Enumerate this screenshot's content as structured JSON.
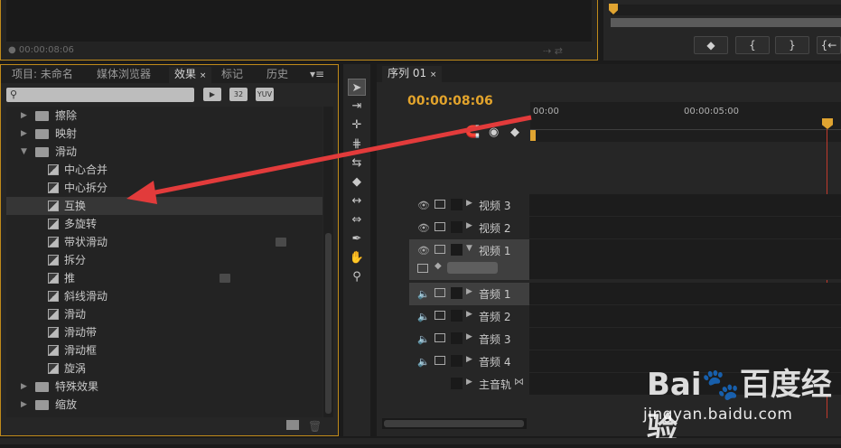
{
  "top_monitor": {
    "timecode": "00:00:08:06"
  },
  "program_monitor": {
    "buttons": [
      "",
      "{",
      "}",
      "{←"
    ]
  },
  "effects_panel": {
    "tabs": [
      {
        "label": "项目: 未命名",
        "active": false
      },
      {
        "label": "媒体浏览器",
        "active": false
      },
      {
        "label": "效果",
        "active": true
      },
      {
        "label": "标记",
        "active": false
      },
      {
        "label": "历史",
        "active": false
      }
    ],
    "search": {
      "value": "",
      "placeholder": ""
    },
    "filters": [
      "",
      "32",
      "YUV"
    ],
    "tree": [
      {
        "label": "擦除",
        "type": "folder",
        "expanded": false
      },
      {
        "label": "映射",
        "type": "folder",
        "expanded": false
      },
      {
        "label": "滑动",
        "type": "folder",
        "expanded": true
      },
      {
        "label": "中心合并",
        "type": "effect"
      },
      {
        "label": "中心拆分",
        "type": "effect"
      },
      {
        "label": "互换",
        "type": "effect",
        "selected": true
      },
      {
        "label": "多旋转",
        "type": "effect"
      },
      {
        "label": "带状滑动",
        "type": "effect",
        "badge": "yuv"
      },
      {
        "label": "拆分",
        "type": "effect"
      },
      {
        "label": "推",
        "type": "effect",
        "badge": "accel"
      },
      {
        "label": "斜线滑动",
        "type": "effect"
      },
      {
        "label": "滑动",
        "type": "effect"
      },
      {
        "label": "滑动带",
        "type": "effect"
      },
      {
        "label": "滑动框",
        "type": "effect"
      },
      {
        "label": "旋涡",
        "type": "effect"
      },
      {
        "label": "特殊效果",
        "type": "folder",
        "expanded": false
      },
      {
        "label": "缩放",
        "type": "folder",
        "expanded": false
      }
    ]
  },
  "sequence_panel": {
    "tab_label": "序列 01",
    "timecode": "00:00:08:06",
    "ruler_labels": [
      "00:00",
      "00:00:05:00"
    ],
    "tracks": [
      {
        "name": "视频 3",
        "kind": "video"
      },
      {
        "name": "视频 2",
        "kind": "video"
      },
      {
        "name": "视频 1",
        "kind": "video",
        "selected": true,
        "expanded": true
      },
      {
        "name": "音频 1",
        "kind": "audio",
        "selected": true
      },
      {
        "name": "音频 2",
        "kind": "audio"
      },
      {
        "name": "音频 3",
        "kind": "audio"
      },
      {
        "name": "音频 4",
        "kind": "audio"
      },
      {
        "name": "主音轨",
        "kind": "master"
      }
    ]
  },
  "tools": [
    "selection-tool",
    "track-select-tool",
    "ripple-edit-tool",
    "rolling-edit-tool",
    "rate-stretch-tool",
    "razor-tool",
    "slip-tool",
    "slide-tool",
    "pen-tool",
    "hand-tool",
    "zoom-tool"
  ],
  "watermark": {
    "logo": "Bai🐾百度经验",
    "url": "jingyan.baidu.com"
  },
  "colors": {
    "accent": "#e3a42c",
    "panel_border": "#c08a1a",
    "playhead": "#c0392b",
    "arrow": "#e23b3b"
  }
}
